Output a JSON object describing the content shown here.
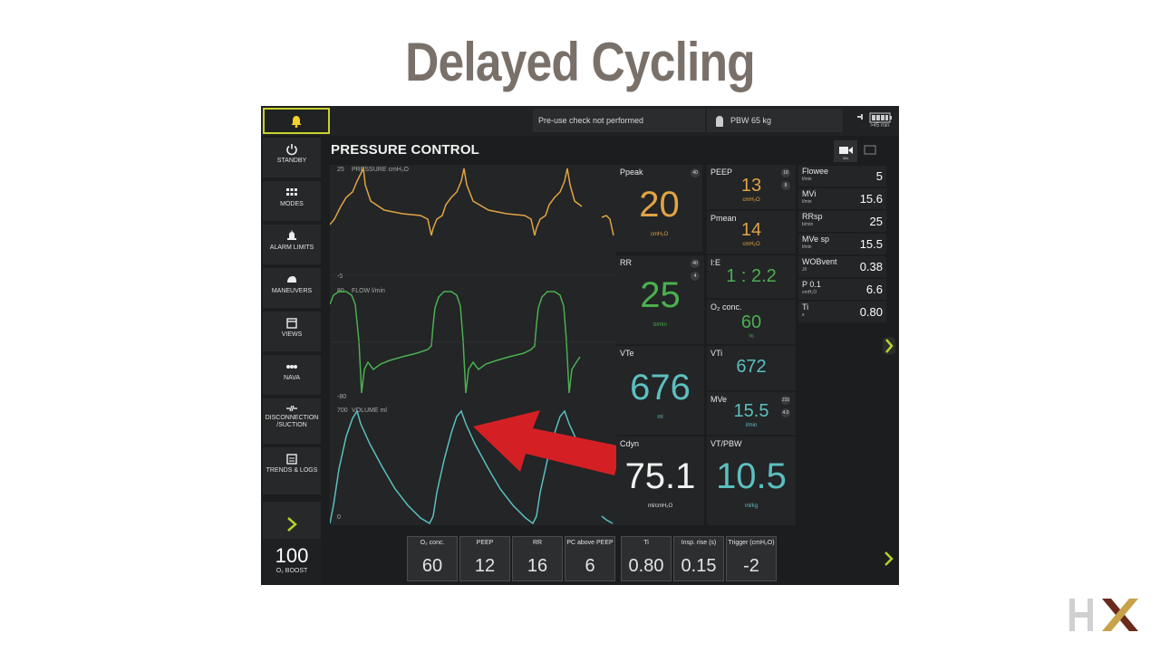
{
  "slide": {
    "title": "Delayed Cycling"
  },
  "topbar": {
    "alarm_icon": "bell-icon",
    "preuse_message": "Pre-use check not performed",
    "pbw_label": "PBW 65 kg",
    "battery_text": ">45 min"
  },
  "sidebar": {
    "items": [
      {
        "label": "STANDBY",
        "icon": "power-icon"
      },
      {
        "label": "MODES",
        "icon": "grid-icon"
      },
      {
        "label": "ALARM LIMITS",
        "icon": "alarm-icon"
      },
      {
        "label": "MANEUVERS",
        "icon": "maneuvers-icon"
      },
      {
        "label": "VIEWS",
        "icon": "views-icon"
      },
      {
        "label": "NAVA",
        "icon": "nava-icon"
      },
      {
        "label": "DISCONNECTION /SUCTION",
        "icon": "disconnection-icon"
      },
      {
        "label": "TRENDS & LOGS",
        "icon": "trends-icon"
      }
    ],
    "boost": {
      "value": "100",
      "label": "O₂ BOOST"
    }
  },
  "mode_title": "PRESSURE CONTROL",
  "graphs": {
    "pressure": {
      "label": "PRESSURE cmH₂O",
      "max": "25",
      "min": "-5",
      "color": "#e0a445"
    },
    "flow": {
      "label": "FLOW l/min",
      "max": "80",
      "min": "-80",
      "color": "#4caf50"
    },
    "volume": {
      "label": "VOLUME ml",
      "max": "700",
      "min": "0",
      "color": "#5cbfc0"
    }
  },
  "values": {
    "ppeak": {
      "label": "Ppeak",
      "value": "20",
      "unit": "cmH₂O",
      "badge": "40"
    },
    "peep": {
      "label": "PEEP",
      "value": "13",
      "unit": "cmH₂O",
      "badge1": "18",
      "badge2": "8"
    },
    "pmean": {
      "label": "Pmean",
      "value": "14",
      "unit": "cmH₂O"
    },
    "rr": {
      "label": "RR",
      "value": "25",
      "unit": "b/min",
      "badge1": "40",
      "badge2": "4"
    },
    "ie": {
      "label": "I:E",
      "value": "1 : 2.2"
    },
    "o2": {
      "label": "O₂ conc.",
      "value": "60",
      "unit": "%"
    },
    "vte": {
      "label": "VTe",
      "value": "676",
      "unit": "ml"
    },
    "vti": {
      "label": "VTi",
      "value": "672",
      "unit": ""
    },
    "mve": {
      "label": "MVe",
      "value": "15.5",
      "unit": "l/min",
      "badge1": "210",
      "badge2": "4.0"
    },
    "cdyn": {
      "label": "Cdyn",
      "value": "75.1",
      "unit": "ml/cmH₂O"
    },
    "vtpbw": {
      "label": "VT/PBW",
      "value": "10.5",
      "unit": "ml/kg"
    }
  },
  "right_table": [
    {
      "label": "Flowee",
      "sub": "l/min",
      "value": "5"
    },
    {
      "label": "MVi",
      "sub": "l/min",
      "value": "15.6"
    },
    {
      "label": "RRsp",
      "sub": "b/min",
      "value": "25"
    },
    {
      "label": "MVe sp",
      "sub": "l/min",
      "value": "15.5"
    },
    {
      "label": "WOBvent",
      "sub": "J/l",
      "value": "0.38"
    },
    {
      "label": "P 0.1",
      "sub": "cmH₂O",
      "value": "6.6"
    },
    {
      "label": "Ti",
      "sub": "s",
      "value": "0.80"
    }
  ],
  "settings": [
    {
      "label": "O₂ conc.",
      "value": "60"
    },
    {
      "label": "PEEP",
      "value": "12"
    },
    {
      "label": "RR",
      "value": "16"
    },
    {
      "label": "PC above PEEP",
      "value": "6"
    },
    {
      "label": "Ti",
      "value": "0.80"
    },
    {
      "label": "Insp. rise (s)",
      "value": "0.15"
    },
    {
      "label": "Trigger (cmH₂O)",
      "value": "-2"
    }
  ],
  "colors": {
    "pressure": "#e0a445",
    "flow": "#4caf50",
    "volume": "#5cbfc0",
    "arrow": "#d42024",
    "accent": "#b4d22a",
    "hx_brown": "#6b2a1c",
    "hx_gold": "#c7a24a"
  },
  "logo": {
    "text": "HX"
  }
}
